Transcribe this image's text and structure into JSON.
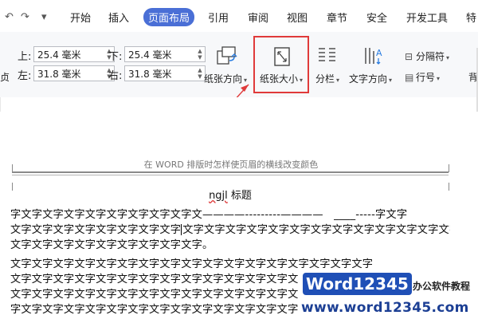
{
  "quick_access": {
    "undo_icon": "↶",
    "redo_icon": "↷",
    "customize_icon": "▾"
  },
  "tabs": [
    {
      "label": "开始"
    },
    {
      "label": "插入"
    },
    {
      "label": "页面布局"
    },
    {
      "label": "引用"
    },
    {
      "label": "审阅"
    },
    {
      "label": "视图"
    },
    {
      "label": "章节"
    },
    {
      "label": "安全"
    },
    {
      "label": "开发工具"
    },
    {
      "label": "特"
    }
  ],
  "accent_color": "#4a6fd6",
  "margins": {
    "top": {
      "label": "上:",
      "value": "25.4 毫米"
    },
    "bottom": {
      "label": "下:",
      "value": "25.4 毫米"
    },
    "left": {
      "label": "左:",
      "value": "31.8 毫米"
    },
    "right": {
      "label": "右:",
      "value": "31.8 毫米"
    },
    "edge_cut": "贞"
  },
  "ribbon": {
    "orientation": "纸张方向",
    "size": "纸张大小",
    "columns": "分栏",
    "text_direction": "文字方向",
    "separator": "分隔符",
    "line_number": "行号",
    "edge_cut": "背"
  },
  "annotation": {
    "highlight_color": "#e03a3a"
  },
  "document": {
    "header_text": "在 WORD 排版时怎样使页眉的横线改变颜色",
    "title_pre": "ngjl",
    "title_post": " 标题",
    "lines": [
      "    字文字文字文字文字文字文字文字文字文————---------————　____-----字文字",
      "文字文字文字文字文字文字文字文字",
      "文字文字文字文字文字文字文字文字文字文字文字文字文字文字文字文字文字",
      "文字文字文字文字文字文字文字文字文字。",
      "    文字文字文字文字文字文字文字文字文字文字文字文字文字文字文字文字文字",
      "文字文字文字文字文字文字文字文字文字文字文字文字文字文",
      "文字文字文字文字文字文字文字文字文字文字文字文字文字文",
      "字文字文字文字文字文字文字文字文字文字文字文字文字文字"
    ]
  },
  "watermark": {
    "logo_text": "Word12345",
    "tagline": "办公软件教程",
    "url": "www.word12345.com"
  }
}
